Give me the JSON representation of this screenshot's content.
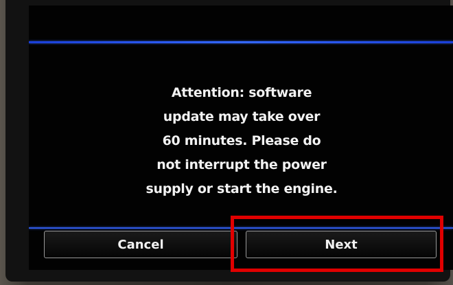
{
  "screen": {
    "message": "Attention: software\nupdate may take over\n60 minutes. Please do\nnot interrupt the power\nsupply or start the engine.",
    "buttons": {
      "cancel_label": "Cancel",
      "next_label": "Next"
    }
  },
  "colors": {
    "accent_line": "#2f5ae6",
    "highlight": "#e00000"
  }
}
